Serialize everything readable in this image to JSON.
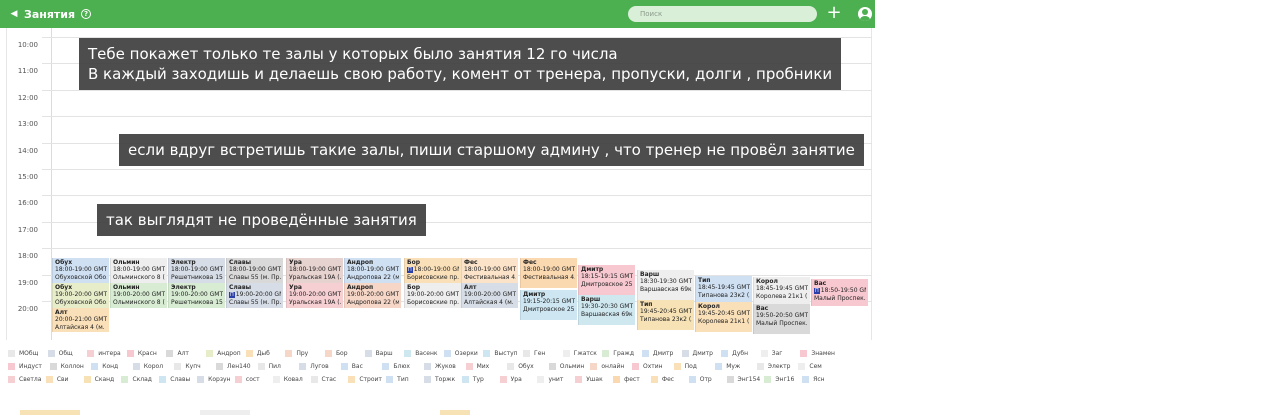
{
  "header": {
    "title": "Занятия",
    "search_placeholder": "Поиск"
  },
  "hours": [
    "10:00",
    "11:00",
    "12:00",
    "13:00",
    "14:00",
    "15:00",
    "16:00",
    "17:00",
    "18:00",
    "19:00",
    "20:00"
  ],
  "notes": [
    "Тебе покажет только те залы у которых было занятия 12 го числа",
    "В каждый заходишь и делаешь свою работу, комент от тренера, пропуски, долги , пробники",
    "если вдруг встретишь такие залы, пиши старшому админу , что тренер не провёл занятие",
    "так выглядят не проведённые занятия"
  ],
  "events": [
    {
      "name": "Обух",
      "time": "18:00-19:00 GMT+3",
      "address": "Обуховской Обо...",
      "color": "#cfe0f3"
    },
    {
      "name": "Обух",
      "time": "19:00-20:00 GMT+3",
      "address": "Обуховской Обо...",
      "color": "#e7edc9"
    },
    {
      "name": "Алт",
      "time": "20:00-21:00 GMT+3",
      "address": "Алтайская 4 (м.",
      "color": "#fae0b9"
    },
    {
      "name": "Ольмин",
      "time": "18:00-19:00 GMT+3",
      "address": "Ольминского 8 (...",
      "color": "#eeeeee"
    },
    {
      "name": "Ольмин",
      "time": "19:00-20:00 GMT+3",
      "address": "Ольминского 8 (...",
      "color": "#d7ecd3"
    },
    {
      "name": "Электр",
      "time": "18:00-19:00 GMT+3",
      "address": "Решетникова 15...",
      "color": "#d6dde6"
    },
    {
      "name": "Электр",
      "time": "19:00-20:00 GMT+3",
      "address": "Решетникова 15...",
      "color": "#d7ecd3"
    },
    {
      "name": "Славы",
      "time": "18:00-19:00 GMT+3",
      "address": "Славы 55 (м. Пр...",
      "color": "#d9d9d9"
    },
    {
      "name": "Славы",
      "badge": "П",
      "time": "19:00-20:00 GMT+3",
      "address": "Славы 55 (м. Пр...",
      "color": "#d6dde6"
    },
    {
      "name": "Ура",
      "time": "18:00-19:00 GMT+3",
      "address": "Уральская 19А (...",
      "color": "#e6d2cf"
    },
    {
      "name": "Ура",
      "time": "19:00-20:00 GMT+3",
      "address": "Уральская 19А (...",
      "color": "#f6cfd3"
    },
    {
      "name": "Андроп",
      "time": "18:00-19:00 GMT+3",
      "address": "Андропова 22 (м...",
      "color": "#cfe0f3"
    },
    {
      "name": "Андроп",
      "time": "19:00-20:00 GMT+3",
      "address": "Андропова 22 (м...",
      "color": "#f6d6c6"
    },
    {
      "name": "Бор",
      "badge": "П",
      "time": "18:00-19:00 GMT",
      "address": "Борисовские пр...",
      "color": "#fae0b9"
    },
    {
      "name": "Бор",
      "time": "19:00-20:00 GMT+3",
      "address": "Борисовские пр...",
      "color": "#eeeeee"
    },
    {
      "name": "Фес",
      "time": "18:00-19:00 GMT+3",
      "address": "Фестивальная 4...",
      "color": "#fbe3c9"
    },
    {
      "name": "Алт",
      "time": "19:00-20:00 GMT+3",
      "address": "Алтайская 4 (м.",
      "color": "#d6dde6"
    },
    {
      "name": "Фес",
      "time": "18:00-19:00 GMT+3",
      "address": "Фестивальная 4...",
      "color": "#fbd9b0"
    },
    {
      "name": "Дмитр",
      "time": "19:15-20:15 GMT+3",
      "address": "Дмитровское 25...",
      "color": "#cde6f2"
    },
    {
      "name": "Дмитр",
      "time": "18:15-19:15 GMT+3",
      "address": "Дмитровское 25...",
      "color": "#f7c8cf"
    },
    {
      "name": "Варш",
      "time": "19:30-20:30 GMT+3",
      "address": "Варшавская 69к...",
      "color": "#cfe8f0"
    },
    {
      "name": "Варш",
      "time": "18:30-19:30 GMT",
      "address": "Варшавская 69к...",
      "color": "#eeeeee"
    },
    {
      "name": "Тип",
      "time": "19:45-20:45 GMT+3",
      "address": "Типанова 23к2 (...",
      "color": "#f6e2b4"
    },
    {
      "name": "Тип",
      "time": "18:45-19:45 GMT+3",
      "address": "Типанова 23к2 (...",
      "color": "#cfe0f3"
    },
    {
      "name": "Корол",
      "time": "19:45-20:45 GMT+3",
      "address": "Королева 21к1 (...",
      "color": "#fae0b9"
    },
    {
      "name": "Корол",
      "time": "18:45-19:45 GMT+3",
      "address": "Королева 21к1 (...",
      "color": "#eeeeee"
    },
    {
      "name": "Вас",
      "time": "19:50-20:50 GMT+3",
      "address": "Малый Проспек...",
      "color": "#d9d9d9"
    },
    {
      "name": "Вас",
      "badge": "П",
      "time": "18:50-19:50 GMT",
      "address": "Малый Проспек...",
      "color": "#f7c8cf"
    }
  ],
  "legend": [
    {
      "label": "МОбщ",
      "color": "#e8e8e8"
    },
    {
      "label": "Общ",
      "color": "#d6dde6"
    },
    {
      "label": "интера",
      "color": "#f6cfd3"
    },
    {
      "label": "Красн",
      "color": "#f7c8cf"
    },
    {
      "label": "Алт",
      "color": "#d9d9d9"
    },
    {
      "label": "Андроп",
      "color": "#e7edc9"
    },
    {
      "label": "Дыб",
      "color": "#fae0b9"
    },
    {
      "label": "Пру",
      "color": "#f6d6c6"
    },
    {
      "label": "Бор",
      "color": "#f6d6c6"
    },
    {
      "label": "Варш",
      "color": "#d6dde6"
    },
    {
      "label": "Васенк",
      "color": "#cfe8f0"
    },
    {
      "label": "Озерки",
      "color": "#cfe0f3"
    },
    {
      "label": "Выступ",
      "color": "#cde6f2"
    },
    {
      "label": "Ген",
      "color": "#e8e8e8"
    },
    {
      "label": "Гжатск",
      "color": "#eeeeee"
    },
    {
      "label": "Гражд",
      "color": "#d7ecd3"
    },
    {
      "label": "Дмитр",
      "color": "#cfe0f3"
    },
    {
      "label": "Дмитр",
      "color": "#d6dde6"
    },
    {
      "label": "Дубн",
      "color": "#cfe0f3"
    },
    {
      "label": "Заг",
      "color": "#eeeeee"
    },
    {
      "label": "Знамен",
      "color": "#f7c8cf"
    },
    {
      "label": "Индуст",
      "color": "#f7c8cf"
    },
    {
      "label": "Коллон",
      "color": "#d9d9d9"
    },
    {
      "label": "Конд",
      "color": "#cfe0f3"
    },
    {
      "label": "Корол",
      "color": "#d6dde6"
    },
    {
      "label": "Купч",
      "color": "#e8e8e8"
    },
    {
      "label": "Лен140",
      "color": "#d9d9d9"
    },
    {
      "label": "Пил",
      "color": "#e8e8e8"
    },
    {
      "label": "Лугов",
      "color": "#d6dde6"
    },
    {
      "label": "Вас",
      "color": "#cfe0f3"
    },
    {
      "label": "Блюх",
      "color": "#cfe0f3"
    },
    {
      "label": "Жуков",
      "color": "#d6dde6"
    },
    {
      "label": "Мих",
      "color": "#f6cfd3"
    },
    {
      "label": "Обух",
      "color": "#e8e8e8"
    },
    {
      "label": "Ольмин",
      "color": "#d9d9d9"
    },
    {
      "label": "онлайн",
      "color": "#f6d6c6"
    },
    {
      "label": "Охтин",
      "color": "#f7c8cf"
    },
    {
      "label": "Под",
      "color": "#fae0b9"
    },
    {
      "label": "Муж",
      "color": "#cfe0f3"
    },
    {
      "label": "Электр",
      "color": "#e8e8e8"
    },
    {
      "label": "Сем",
      "color": "#eeeeee"
    },
    {
      "label": "Светла",
      "color": "#f6cfd3"
    },
    {
      "label": "Сви",
      "color": "#fae0b9"
    },
    {
      "label": "Сканд",
      "color": "#f6e2b4"
    },
    {
      "label": "Склад",
      "color": "#d7ecd3"
    },
    {
      "label": "Славы",
      "color": "#cde6f2"
    },
    {
      "label": "Корзун",
      "color": "#d6dde6"
    },
    {
      "label": "сост",
      "color": "#f6cfd3"
    },
    {
      "label": "Ковал",
      "color": "#eeeeee"
    },
    {
      "label": "Стас",
      "color": "#e8e8e8"
    },
    {
      "label": "Строит",
      "color": "#fae0b9"
    },
    {
      "label": "Тип",
      "color": "#cfe0f3"
    },
    {
      "label": "Торжк",
      "color": "#d6dde6"
    },
    {
      "label": "Тур",
      "color": "#cde6f2"
    },
    {
      "label": "Ура",
      "color": "#f6cfd3"
    },
    {
      "label": "унит",
      "color": "#eeeeee"
    },
    {
      "label": "Ушак",
      "color": "#f6cfd3"
    },
    {
      "label": "фест",
      "color": "#fbd9b0"
    },
    {
      "label": "Фес",
      "color": "#fae0b9"
    },
    {
      "label": "Отр",
      "color": "#cfe0f3"
    },
    {
      "label": "Энг154",
      "color": "#d9d9d9"
    },
    {
      "label": "Энг16",
      "color": "#d7ecd3"
    },
    {
      "label": "Ясн",
      "color": "#cfe0f3"
    }
  ]
}
